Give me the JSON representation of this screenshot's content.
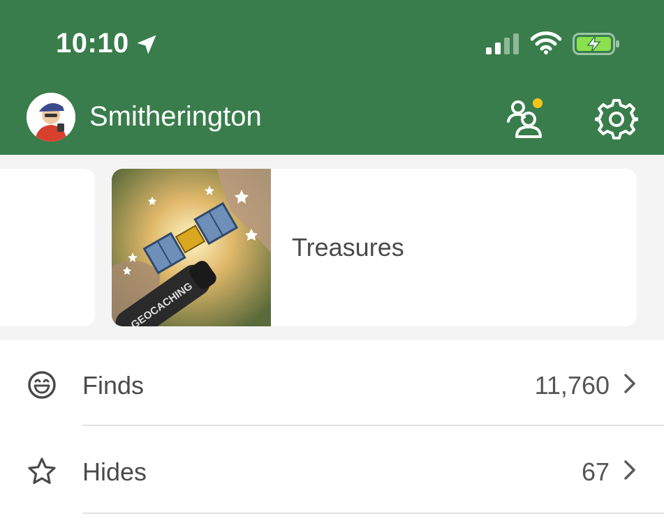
{
  "status_bar": {
    "time": "10:10",
    "icons": [
      "location-arrow-icon",
      "cellular-signal-icon",
      "wifi-icon",
      "battery-charging-icon"
    ],
    "battery_color": "#8be04e"
  },
  "header": {
    "username": "Smitherington",
    "background": "#3a7d4c",
    "notification_dot_color": "#f5c518",
    "icons": [
      "friends-icon",
      "settings-gear-icon"
    ]
  },
  "carousel": {
    "cards": [
      {
        "label": ""
      },
      {
        "label": "Treasures",
        "image_text": "GEOCACHING"
      }
    ]
  },
  "stats": [
    {
      "label": "Finds",
      "value": "11,760",
      "icon": "smiley-icon"
    },
    {
      "label": "Hides",
      "value": "67",
      "icon": "star-icon"
    }
  ]
}
